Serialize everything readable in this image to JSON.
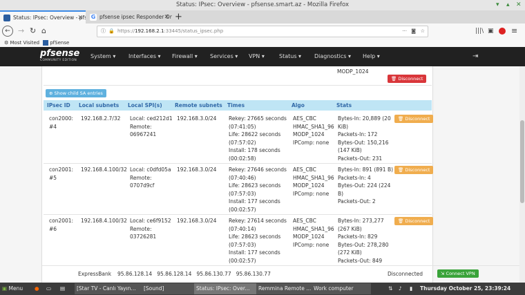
{
  "window": {
    "title": "Status: IPsec: Overview - pfsense.smart.az - Mozilla Firefox"
  },
  "tabs": [
    {
      "label": "Status: IPsec: Overview - pfse",
      "icon": "pfsense-favicon-icon"
    },
    {
      "label": "pfsense ipsec Responder Onl",
      "icon": "google-favicon-icon"
    }
  ],
  "url": {
    "prefix": "https://",
    "host": "192.168.2.1",
    "rest": ":33445/status_ipsec.php",
    "more": "···"
  },
  "bookmarks": [
    "Most Visited",
    "pfSense"
  ],
  "pf_nav": {
    "logo": "pfsense",
    "logo_sub": "COMMUNITY EDITION",
    "menu": [
      "System ▾",
      "Interfaces ▾",
      "Firewall ▾",
      "Services ▾",
      "VPN ▾",
      "Status ▾",
      "Diagnostics ▾",
      "Help ▾"
    ]
  },
  "top_fragment": {
    "text": "MODP_1024",
    "disconnect": "Disconnect"
  },
  "show_child": "Show child SA entries",
  "table": {
    "headers": [
      "IPsec ID",
      "Local subnets",
      "Local SPI(s)",
      "Remote subnets",
      "Times",
      "Algo",
      "Stats"
    ],
    "rows": [
      {
        "id": [
          "con2000:",
          "#4"
        ],
        "local_subnet": "192.168.2.7/32",
        "spi": [
          "Local: ced212d1",
          "Remote:",
          "06967241"
        ],
        "remote_subnet": "192.168.3.0/24",
        "times": [
          "Rekey: 27665 seconds",
          "(07:41:05)",
          "Life: 28622 seconds",
          "(07:57:02)",
          "Install: 178 seconds",
          "(00:02:58)"
        ],
        "algo": [
          "AES_CBC",
          "HMAC_SHA1_96",
          "MODP_1024",
          "IPComp: none"
        ],
        "stats": [
          "Bytes-In: 20,889 (20",
          "KiB)",
          "Packets-In: 172",
          "Bytes-Out: 150,216",
          "(147 KiB)",
          "Packets-Out: 231"
        ],
        "button": "Disconnect"
      },
      {
        "id": [
          "con2001:",
          "#5"
        ],
        "local_subnet": "192.168.4.100/32",
        "spi": [
          "Local: c0dfd05a",
          "Remote:",
          "0707d9cf"
        ],
        "remote_subnet": "192.168.3.0/24",
        "times": [
          "Rekey: 27646 seconds",
          "(07:40:46)",
          "Life: 28623 seconds",
          "(07:57:03)",
          "Install: 177 seconds",
          "(00:02:57)"
        ],
        "algo": [
          "AES_CBC",
          "HMAC_SHA1_96",
          "MODP_1024",
          "IPComp: none"
        ],
        "stats": [
          "Bytes-In: 891 (891 B)",
          "Packets-In: 4",
          "Bytes-Out: 224 (224",
          "B)",
          "Packets-Out: 2"
        ],
        "button": "Disconnect"
      },
      {
        "id": [
          "con2001:",
          "#6"
        ],
        "local_subnet": "192.168.4.100/32",
        "spi": [
          "Local: ce6f9152",
          "Remote:",
          "03726281"
        ],
        "remote_subnet": "192.168.3.0/24",
        "times": [
          "Rekey: 27614 seconds",
          "(07:40:14)",
          "Life: 28623 seconds",
          "(07:57:03)",
          "Install: 177 seconds",
          "(00:02:57)"
        ],
        "algo": [
          "AES_CBC",
          "HMAC_SHA1_96",
          "MODP_1024",
          "IPComp: none"
        ],
        "stats": [
          "Bytes-In: 273,277",
          "(267 KiB)",
          "Packets-In: 829",
          "Bytes-Out: 278,280",
          "(272 KiB)",
          "Packets-Out: 849"
        ],
        "button": "Disconnect"
      }
    ]
  },
  "bottom_row": {
    "name": "ExpressBank",
    "ips": "95.86.128.14   95.86.128.14   95.86.130.77   95.86.130.77",
    "status": "Disconnected",
    "button": "Connect VPN"
  },
  "taskbar": {
    "menu": "Menu",
    "windows": [
      "[Star TV - Canlı Yayın...",
      "[Sound]",
      "Status: IPsec: Over...",
      "Remmina Remote ...",
      "Work computer"
    ],
    "clock": "Thursday October 25, 23:39:24"
  },
  "colors": {
    "pf_dark": "#212121",
    "table_head": "#bfe5f5",
    "disconnect_red": "#d9363a",
    "disconnect_orange": "#f0ad4e",
    "connect_green": "#3aa33a"
  }
}
